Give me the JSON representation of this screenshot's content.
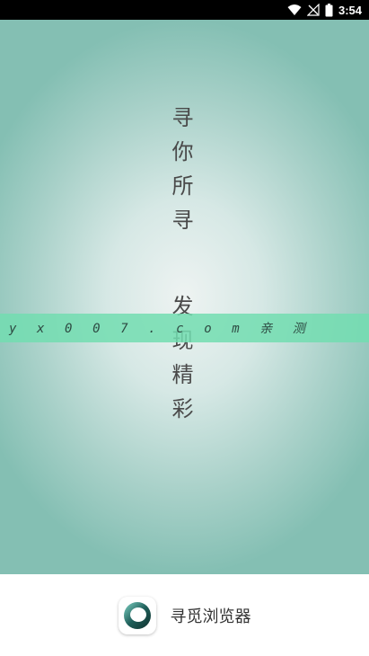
{
  "status_bar": {
    "time": "3:54",
    "icons": [
      "wifi-icon",
      "no-signal-icon",
      "battery-icon"
    ]
  },
  "splash": {
    "vertical_text_top": "寻你所寻",
    "vertical_text_bottom": "发现精彩",
    "url_banner": "yx007.com亲测",
    "banner_color": "#72ddb0"
  },
  "app": {
    "name": "寻觅浏览器",
    "icon": "app-logo-icon"
  }
}
